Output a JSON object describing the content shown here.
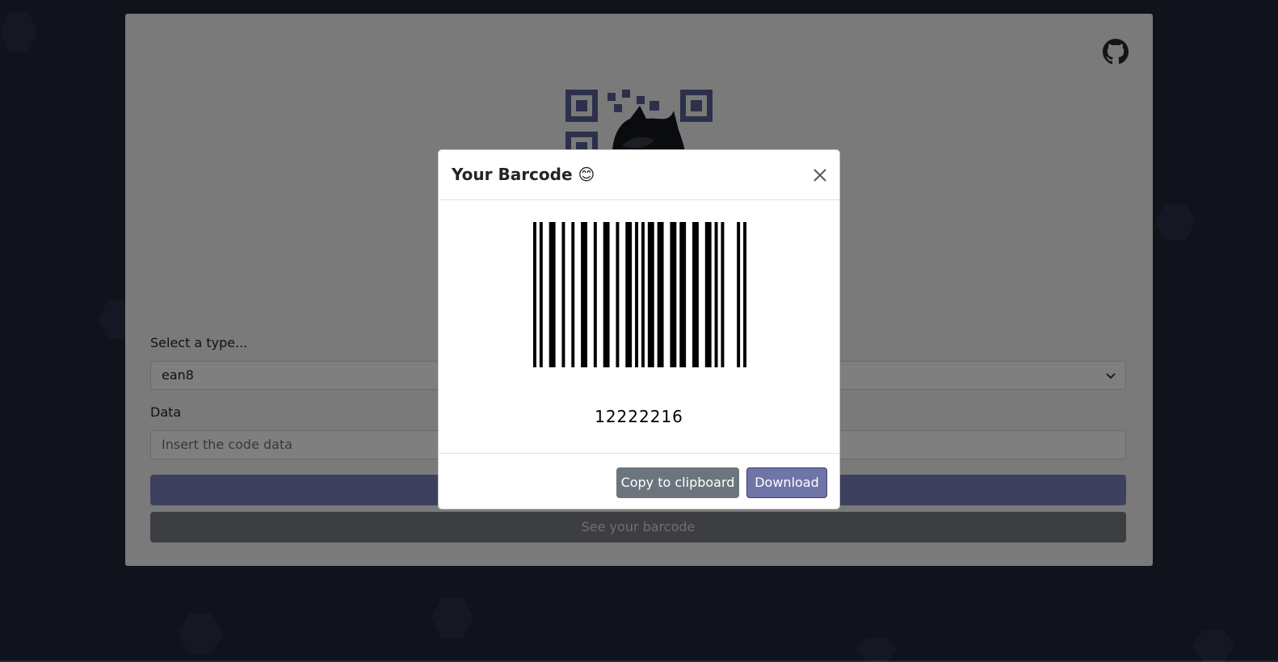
{
  "form": {
    "type_label": "Select a type...",
    "type_value": "ean8",
    "data_label": "Data",
    "data_placeholder": "Insert the code data",
    "see_button": "See your barcode"
  },
  "modal": {
    "title": "Your Barcode 😊",
    "code_value": "12222216",
    "copy_button": "Copy to clipboard",
    "download_button": "Download"
  },
  "icons": {
    "github": "github-icon",
    "close": "close-icon",
    "chevron": "chevron-down-icon"
  },
  "colors": {
    "background": "#222638",
    "primary": "#7075a8",
    "secondary": "#6c757d"
  }
}
